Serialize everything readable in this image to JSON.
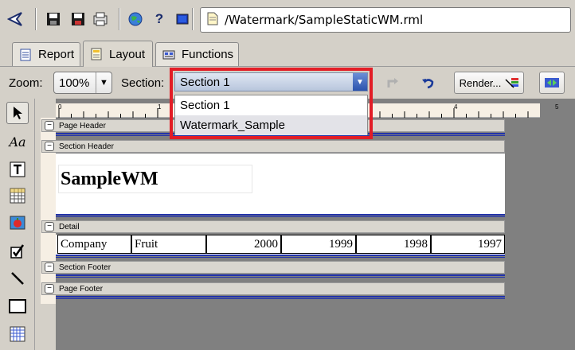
{
  "toolbar": {
    "path": "/Watermark/SampleStaticWM.rml",
    "icons": [
      "back-arrow-icon",
      "save-icon",
      "save-as-icon",
      "print-preview-icon",
      "globe-icon",
      "help-icon",
      "image-icon",
      "file-icon"
    ]
  },
  "tabs": [
    {
      "label": "Report",
      "active": false
    },
    {
      "label": "Layout",
      "active": true
    },
    {
      "label": "Functions",
      "active": false
    }
  ],
  "controls": {
    "zoom_label": "Zoom:",
    "zoom_value": "100%",
    "section_label": "Section:",
    "section_value": "Section 1",
    "render_label": "Render..."
  },
  "dropdown": {
    "options": [
      "Section 1",
      "Watermark_Sample"
    ]
  },
  "ruler": {
    "marks": [
      "0",
      "1",
      "4",
      "5"
    ]
  },
  "bands": {
    "page_header": "Page Header",
    "section_header": "Section Header",
    "detail": "Detail",
    "section_footer": "Section Footer",
    "page_footer": "Page Footer"
  },
  "report": {
    "title": "SampleWM",
    "detail_cells": [
      "Company",
      "Fruit",
      "2000",
      "1999",
      "1998",
      "1997"
    ]
  },
  "colors": {
    "highlight": "#e21d26",
    "band_line": "#2233aa"
  }
}
